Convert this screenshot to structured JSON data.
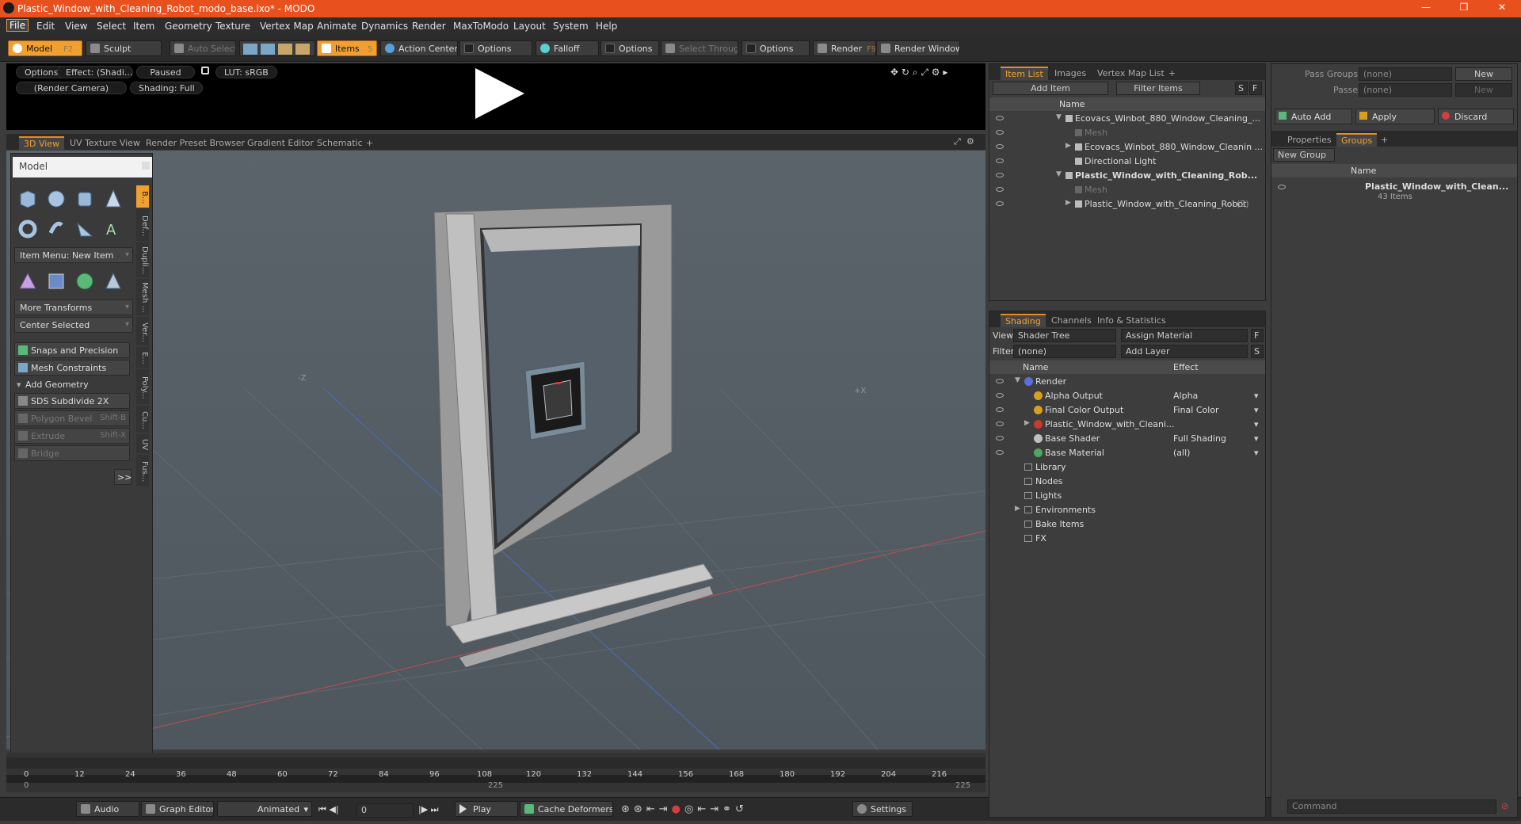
{
  "window": {
    "title": "Plastic_Window_with_Cleaning_Robot_modo_base.lxo* - MODO",
    "minimize": "—",
    "restore": "❐",
    "close": "✕"
  },
  "menu": [
    "File",
    "Edit",
    "View",
    "Select",
    "Item",
    "Geometry",
    "Texture",
    "Vertex Map",
    "Animate",
    "Dynamics",
    "Render",
    "MaxToModo",
    "Layout",
    "System",
    "Help"
  ],
  "toolbar": {
    "model": "Model",
    "model_key": "F2",
    "sculpt": "Sculpt",
    "auto_select": "Auto Select",
    "items": "Items",
    "items_key": "5",
    "action_center": "Action Center",
    "options1": "Options",
    "falloff": "Falloff",
    "options2": "Options",
    "select_through": "Select Through",
    "options3": "Options",
    "render": "Render",
    "render_key": "F9",
    "render_window": "Render Window"
  },
  "preview": {
    "options": "Options",
    "effect": "Effect: (Shadi...",
    "paused": "Paused",
    "lut": "LUT: sRGB",
    "camera": "(Render Camera)",
    "shading": "Shading: Full"
  },
  "view_tabs": [
    "3D View",
    "UV Texture View",
    "Render Preset Browser",
    "Gradient Editor",
    "Schematic"
  ],
  "add_tab": "+",
  "tool_panel": {
    "title": "Model",
    "item_menu": "Item Menu: New Item",
    "more_transforms": "More Transforms",
    "center_selected": "Center Selected",
    "snaps": "Snaps and Precision",
    "mesh_constraints": "Mesh Constraints",
    "add_geometry": "Add Geometry",
    "sds": "SDS Subdivide 2X",
    "polygon_bevel": "Polygon Bevel",
    "polygon_bevel_key": "Shift-B",
    "extrude": "Extrude",
    "extrude_key": "Shift-X",
    "bridge": "Bridge",
    "more": ">>",
    "side_tabs": [
      "B...",
      "Def...",
      "Dupli...",
      "Mesh ...",
      "Ver...",
      "E...",
      "Poly...",
      "Cu...",
      "UV",
      "Fus..."
    ]
  },
  "viewport": {
    "axis_z": "-Z",
    "axis_x": "+X"
  },
  "timeline": {
    "ticks": [
      "0",
      "12",
      "24",
      "36",
      "48",
      "60",
      "72",
      "84",
      "96",
      "108",
      "120",
      "132",
      "144",
      "156",
      "168",
      "180",
      "192",
      "204",
      "216"
    ],
    "start": "0",
    "mid": "225",
    "end": "225"
  },
  "transport": {
    "audio": "Audio",
    "graph_editor": "Graph Editor",
    "animated": "Animated",
    "frame": "0",
    "play": "Play",
    "cache_deformers": "Cache Deformers",
    "settings": "Settings"
  },
  "item_list": {
    "tabs": [
      "Item List",
      "Images",
      "Vertex Map List"
    ],
    "add_item": "Add Item",
    "filter_items": "Filter Items",
    "s": "S",
    "f": "F",
    "name_header": "Name",
    "rows": [
      {
        "label": "Ecovacs_Winbot_880_Window_Cleaning_...",
        "indent": 0,
        "arrow": "▼",
        "dim": false,
        "bold": false
      },
      {
        "label": "Mesh",
        "indent": 1,
        "arrow": "",
        "dim": true,
        "bold": false
      },
      {
        "label": "Ecovacs_Winbot_880_Window_Cleanin ...",
        "indent": 1,
        "arrow": "▶",
        "dim": false,
        "bold": false
      },
      {
        "label": "Directional Light",
        "indent": 1,
        "arrow": "",
        "dim": false,
        "bold": false
      },
      {
        "label": "Plastic_Window_with_Cleaning_Rob...",
        "indent": 0,
        "arrow": "▼",
        "dim": false,
        "bold": true
      },
      {
        "label": "Mesh",
        "indent": 1,
        "arrow": "",
        "dim": true,
        "bold": false
      },
      {
        "label": "Plastic_Window_with_Cleaning_Robot",
        "indent": 1,
        "arrow": "▶",
        "dim": false,
        "bold": false,
        "suffix": "(2)"
      }
    ]
  },
  "shading": {
    "tabs": [
      "Shading",
      "Channels",
      "Info & Statistics"
    ],
    "view_label": "View",
    "view_value": "Shader Tree",
    "assign_material": "Assign Material",
    "filter_label": "Filter",
    "filter_value": "(none)",
    "add_layer": "Add Layer",
    "f": "F",
    "s": "S",
    "name_header": "Name",
    "effect_header": "Effect",
    "rows": [
      {
        "label": "Render",
        "effect": "",
        "indent": 0,
        "arrow": "▼",
        "color": "#5a6fd8"
      },
      {
        "label": "Alpha Output",
        "effect": "Alpha",
        "indent": 1,
        "arrow": "",
        "color": "#d8a020"
      },
      {
        "label": "Final Color Output",
        "effect": "Final Color",
        "indent": 1,
        "arrow": "",
        "color": "#d8a020"
      },
      {
        "label": "Plastic_Window_with_Cleani...",
        "effect": "",
        "indent": 1,
        "arrow": "▶",
        "color": "#c83a2a"
      },
      {
        "label": "Base Shader",
        "effect": "Full Shading",
        "indent": 1,
        "arrow": "",
        "color": "#c0c0c0"
      },
      {
        "label": "Base Material",
        "effect": "(all)",
        "indent": 1,
        "arrow": "",
        "color": "#4aa860"
      },
      {
        "label": "Library",
        "effect": "",
        "indent": 0,
        "arrow": "",
        "color": ""
      },
      {
        "label": "Nodes",
        "effect": "",
        "indent": 0,
        "arrow": "",
        "color": ""
      },
      {
        "label": "Lights",
        "effect": "",
        "indent": 0,
        "arrow": "",
        "color": ""
      },
      {
        "label": "Environments",
        "effect": "",
        "indent": 0,
        "arrow": "▶",
        "color": ""
      },
      {
        "label": "Bake Items",
        "effect": "",
        "indent": 0,
        "arrow": "",
        "color": ""
      },
      {
        "label": "FX",
        "effect": "",
        "indent": 0,
        "arrow": "",
        "color": ""
      }
    ]
  },
  "groups": {
    "pass_groups_label": "Pass Groups",
    "pass_groups_value": "(none)",
    "passes_label": "Passes",
    "passes_value": "(none)",
    "new1": "New",
    "new2": "New",
    "auto_add": "Auto Add",
    "apply": "Apply",
    "discard": "Discard",
    "tabs": [
      "Properties",
      "Groups"
    ],
    "new_group": "New Group",
    "name_header": "Name",
    "group_name": "Plastic_Window_with_Clean...",
    "group_count": "43 Items",
    "command_placeholder": "Command"
  }
}
